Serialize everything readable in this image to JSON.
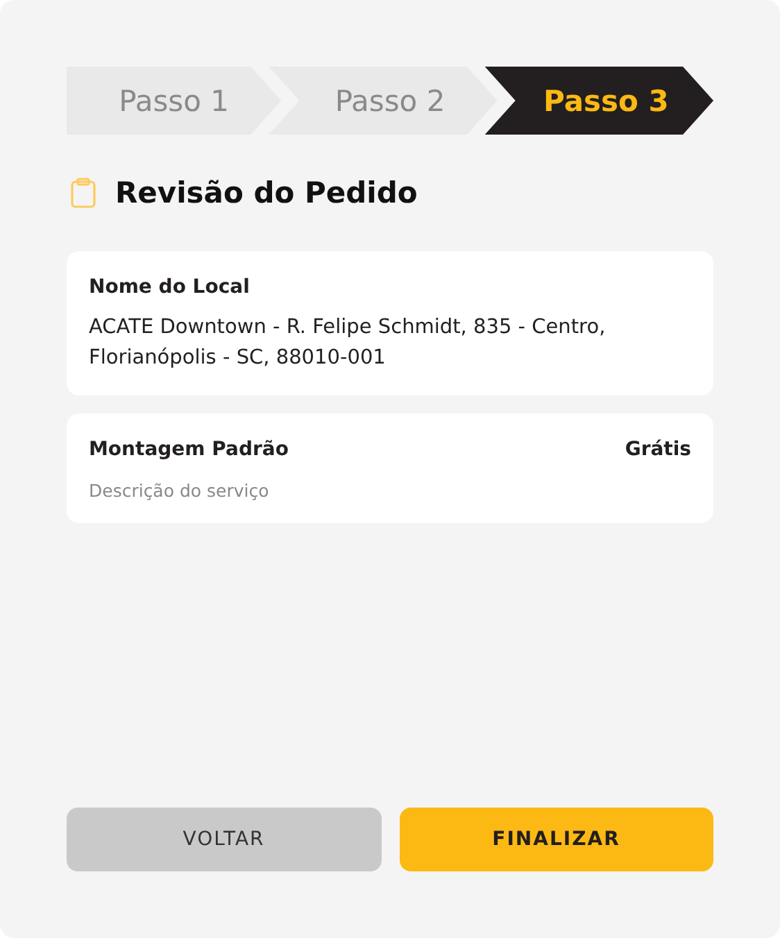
{
  "steps": [
    {
      "label": "Passo 1",
      "selected": false
    },
    {
      "label": "Passo 2",
      "selected": false
    },
    {
      "label": "Passo 3",
      "selected": true
    }
  ],
  "title": "Revisão do Pedido",
  "location": {
    "label": "Nome do Local",
    "address": "ACATE Downtown - R. Felipe Schmidt, 835 - Centro, Florianópolis - SC, 88010-001"
  },
  "service": {
    "name": "Montagem Padrão",
    "price": "Grátis",
    "description": "Descrição do serviço"
  },
  "buttons": [
    {
      "label": "VOLTAR",
      "kind": "secondary"
    },
    {
      "label": "FINALIZAR",
      "kind": "primary"
    }
  ]
}
